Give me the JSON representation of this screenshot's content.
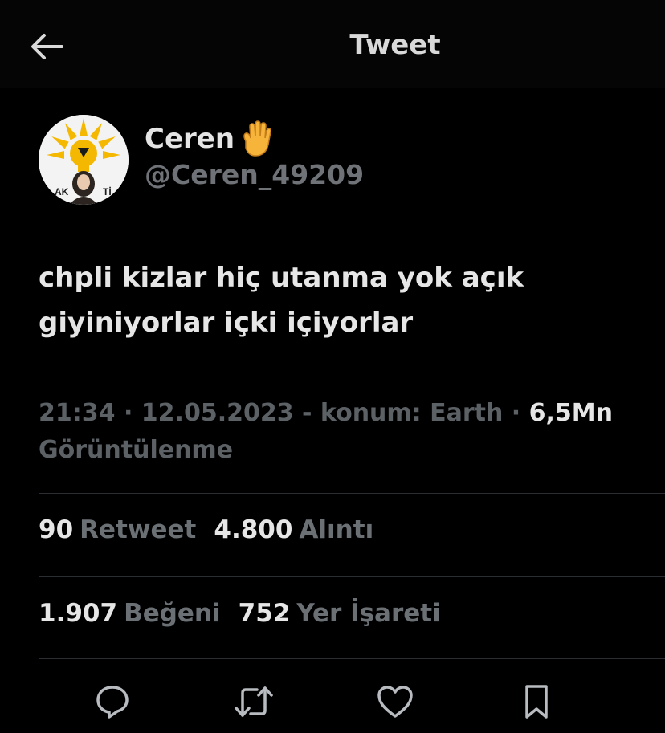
{
  "header": {
    "title": "Tweet",
    "back_icon": "arrow-left-icon"
  },
  "author": {
    "display_name": "Ceren",
    "name_emoji": "raised-hand-icon",
    "handle": "@Ceren_49209",
    "avatar_logo_text_left": "AK",
    "avatar_logo_text_right": "Tİ"
  },
  "tweet": {
    "text_line1": "chpli kizlar hiç utanma yok açık",
    "text_line2": "giyiniyorlar içki içiyorlar"
  },
  "meta": {
    "time": "21:34",
    "sep1": " · ",
    "date": "12.05.2023",
    "location": " - konum: Earth",
    "sep2": " · ",
    "views_count": "6,5Mn",
    "views_label": "Görüntülenme"
  },
  "stats": {
    "retweets_count": "90",
    "retweets_label": "Retweet",
    "quotes_count": "4.800",
    "quotes_label": "Alıntı",
    "likes_count": "1.907",
    "likes_label": "Beğeni",
    "bookmarks_count": "752",
    "bookmarks_label": "Yer İşareti"
  },
  "actions": [
    "reply-icon",
    "retweet-icon",
    "like-icon",
    "bookmark-icon"
  ],
  "colors": {
    "background": "#000000",
    "text_primary": "#e6e6e6",
    "text_secondary": "#6b7075",
    "divider": "#2a2d31",
    "ak_parti_yellow": "#f5b800"
  }
}
